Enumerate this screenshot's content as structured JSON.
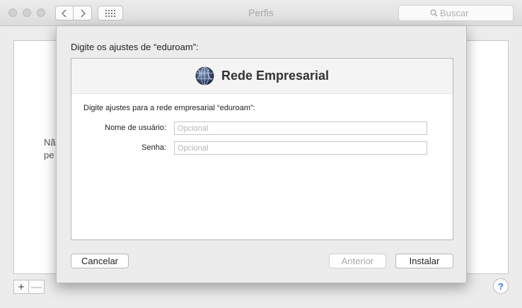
{
  "window": {
    "title": "Perfis",
    "search_placeholder": "Buscar"
  },
  "background": {
    "text_line1": "Nã",
    "text_line2": "pe",
    "add_label": "+",
    "remove_label": "—",
    "help_label": "?"
  },
  "sheet": {
    "heading": "Digite os ajustes de “eduroam”:",
    "panel_title": "Rede Empresarial",
    "description": "Digite ajustes para a rede empresarial “eduroam”:",
    "username_label": "Nome de usuário:",
    "username_placeholder": "Opcional",
    "username_value": "",
    "password_label": "Senha:",
    "password_placeholder": "Opcional",
    "password_value": "",
    "cancel_label": "Cancelar",
    "previous_label": "Anterior",
    "install_label": "Instalar"
  },
  "icons": {
    "back": "chevron-left-icon",
    "forward": "chevron-right-icon",
    "grid": "grid-icon",
    "search": "search-icon",
    "network": "globe-icon"
  },
  "colors": {
    "help_accent": "#2f7bf5"
  }
}
